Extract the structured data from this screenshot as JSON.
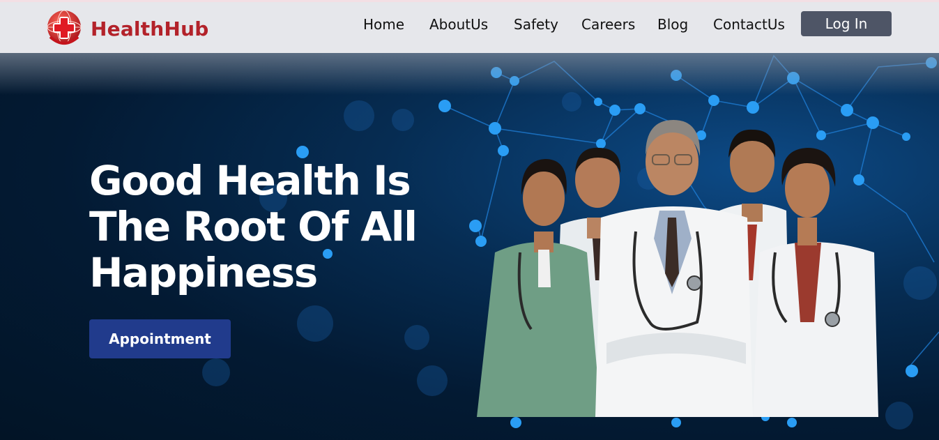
{
  "brand": {
    "name": "HealthHub",
    "logo_icon": "medical-cross-globe-icon",
    "color": "#b3222a"
  },
  "nav": {
    "items": [
      {
        "label": "Home"
      },
      {
        "label": "AboutUs"
      },
      {
        "label": "Safety"
      },
      {
        "label": "Careers"
      },
      {
        "label": "Blog"
      },
      {
        "label": "ContactUs"
      }
    ],
    "login_label": "Log In"
  },
  "hero": {
    "headline_lines": [
      "Good Health Is",
      "The Root Of All",
      "Happiness"
    ],
    "cta_label": "Appointment",
    "image": "group-of-doctors-photo"
  },
  "colors": {
    "navbar_bg": "#e6e7eb",
    "login_bg": "#4e5566",
    "cta_bg": "#213b8c",
    "hero_bg": "#021426",
    "network_node": "#2a9df4"
  }
}
